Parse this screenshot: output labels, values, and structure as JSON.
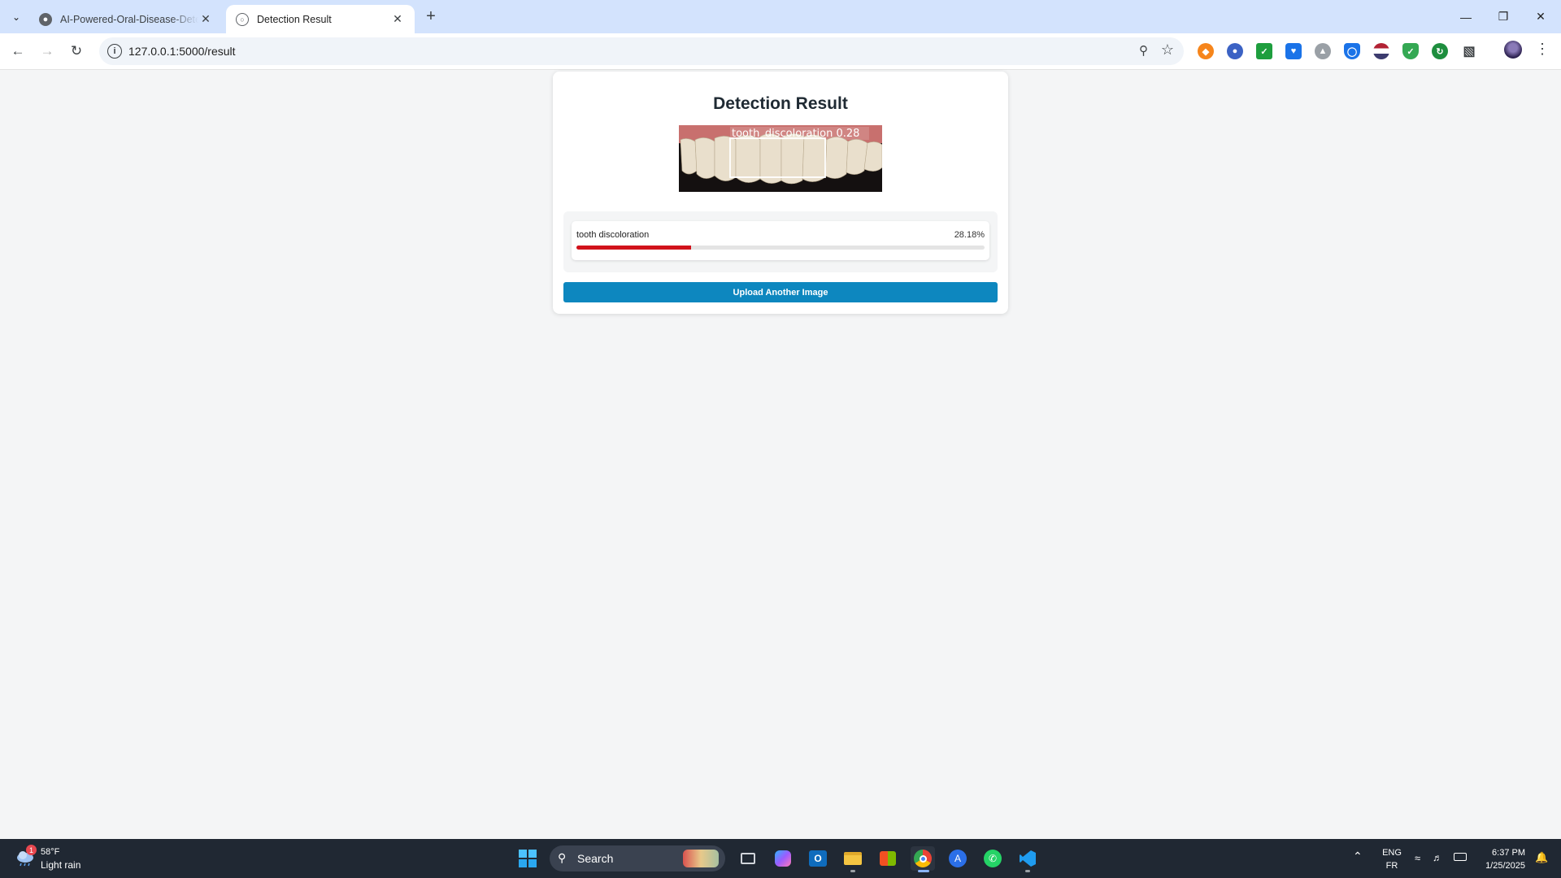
{
  "browser": {
    "tabs": [
      {
        "title": "AI-Powered-Oral-Disease-Detection",
        "active": false
      },
      {
        "title": "Detection Result",
        "active": true
      }
    ],
    "url": "127.0.0.1:5000/result",
    "extension_icons": [
      "metamask-icon",
      "blue-extension-icon",
      "green-check-extension-icon",
      "blue-bookmark-extension-icon",
      "gray-extension-icon",
      "shield-extension-icon",
      "flag-extension-icon",
      "green-shield-extension-icon",
      "green-refresh-extension-icon",
      "puzzle-icon"
    ]
  },
  "page": {
    "title": "Detection Result",
    "image_overlay_label": "tooth_discoloration  0.28",
    "detections": [
      {
        "label": "tooth discoloration",
        "percent_text": "28.18%",
        "fraction": 0.2818,
        "bar_color": "#d1121b"
      }
    ],
    "upload_button": "Upload Another Image",
    "accent_color": "#0d87bf"
  },
  "taskbar": {
    "weather_temp": "58°F",
    "weather_condition": "Light rain",
    "weather_badge": "1",
    "search_placeholder": "Search",
    "lang_top": "ENG",
    "lang_bottom": "FR",
    "time": "6:37 PM",
    "date": "1/25/2025"
  }
}
